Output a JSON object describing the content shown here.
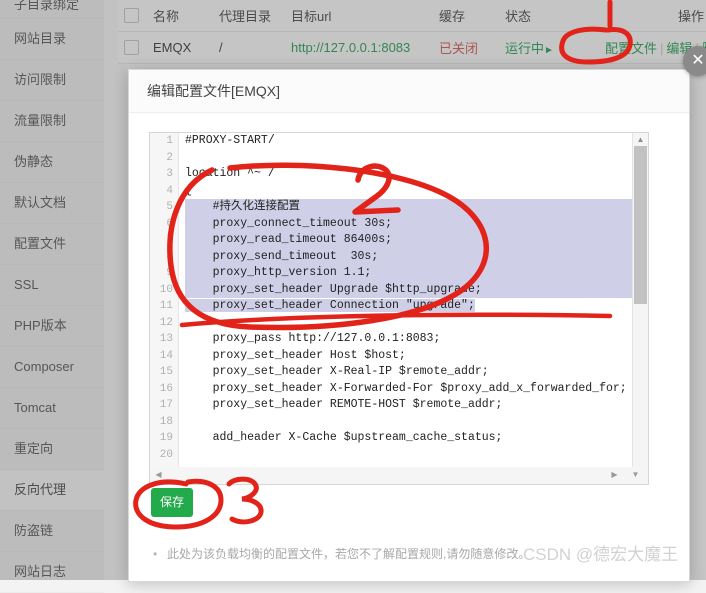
{
  "sidebar": {
    "items": [
      {
        "label": "子目录绑定",
        "active": false,
        "clipped": true
      },
      {
        "label": "网站目录",
        "active": false
      },
      {
        "label": "访问限制",
        "active": false
      },
      {
        "label": "流量限制",
        "active": false
      },
      {
        "label": "伪静态",
        "active": false
      },
      {
        "label": "默认文档",
        "active": false
      },
      {
        "label": "配置文件",
        "active": false
      },
      {
        "label": "SSL",
        "active": false
      },
      {
        "label": "PHP版本",
        "active": false
      },
      {
        "label": "Composer",
        "active": false
      },
      {
        "label": "Tomcat",
        "active": false
      },
      {
        "label": "重定向",
        "active": false
      },
      {
        "label": "反向代理",
        "active": true
      },
      {
        "label": "防盗链",
        "active": false
      },
      {
        "label": "网站日志",
        "active": false
      }
    ]
  },
  "table": {
    "headers": [
      "名称",
      "代理目录",
      "目标url",
      "缓存",
      "状态",
      "操作"
    ],
    "row": {
      "name": "EMQX",
      "dir": "/",
      "url": "http://127.0.0.1:8083",
      "cache": "已关闭",
      "state": "运行中",
      "state_icon": "play-icon",
      "ops": [
        "配置文件",
        "编辑",
        "删除"
      ]
    }
  },
  "modal": {
    "title": "编辑配置文件[EMQX]",
    "close_icon": "close-icon",
    "save_label": "保存",
    "note": "此处为该负载均衡的配置文件，若您不了解配置规则,请勿随意修改。",
    "editor": {
      "first_line": 1,
      "selected_lines": [
        5,
        6,
        7,
        8,
        9,
        10,
        11
      ],
      "lines": [
        "#PROXY-START/",
        "",
        "location ^~ /",
        "{",
        "    #持久化连接配置",
        "    proxy_connect_timeout 30s;",
        "    proxy_read_timeout 86400s;",
        "    proxy_send_timeout  30s;",
        "    proxy_http_version 1.1;",
        "    proxy_set_header Upgrade $http_upgrade;",
        "    proxy_set_header Connection \"upgrade\";",
        "",
        "    proxy_pass http://127.0.0.1:8083;",
        "    proxy_set_header Host $host;",
        "    proxy_set_header X-Real-IP $remote_addr;",
        "    proxy_set_header X-Forwarded-For $proxy_add_x_forwarded_for;",
        "    proxy_set_header REMOTE-HOST $remote_addr;",
        "",
        "    add_header X-Cache $upstream_cache_status;",
        ""
      ],
      "scroll_up_icon": "triangle-up-icon",
      "scroll_down_icon": "triangle-down-icon",
      "scroll_left_icon": "triangle-left-icon",
      "scroll_right_icon": "triangle-right-icon"
    }
  },
  "annotations": {
    "color": "#e2231a",
    "marks": [
      {
        "label": "1",
        "kind": "stroke-above-circle",
        "target": "配置文件"
      },
      {
        "label": "2",
        "kind": "lasso-circle",
        "target": "selected config block"
      },
      {
        "label": "3",
        "kind": "circle",
        "target": "保存"
      }
    ],
    "label_1": "1",
    "label_2": "2",
    "label_3": "3"
  },
  "watermark": {
    "text": "CSDN @德宏大魔王"
  }
}
